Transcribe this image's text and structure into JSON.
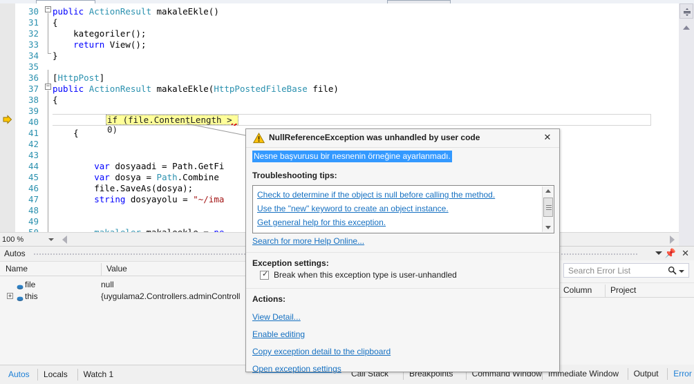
{
  "editor": {
    "zoom_level": "100 %",
    "lines": [
      {
        "num": "30",
        "indent": 0,
        "tokens": [
          {
            "t": "public ",
            "c": "kw"
          },
          {
            "t": "ActionResult ",
            "c": "typ"
          },
          {
            "t": "makaleEkle()",
            "c": "pln"
          }
        ]
      },
      {
        "num": "31",
        "indent": 0,
        "tokens": [
          {
            "t": "{",
            "c": "pln"
          }
        ]
      },
      {
        "num": "32",
        "indent": 0,
        "tokens": [
          {
            "t": "    kategoriler();",
            "c": "pln"
          }
        ]
      },
      {
        "num": "33",
        "indent": 0,
        "tokens": [
          {
            "t": "    ",
            "c": "pln"
          },
          {
            "t": "return ",
            "c": "kw"
          },
          {
            "t": "View();",
            "c": "pln"
          }
        ]
      },
      {
        "num": "34",
        "indent": 0,
        "tokens": [
          {
            "t": "}",
            "c": "pln"
          }
        ]
      },
      {
        "num": "35",
        "indent": 0,
        "tokens": []
      },
      {
        "num": "36",
        "indent": 0,
        "tokens": [
          {
            "t": "[",
            "c": "pln"
          },
          {
            "t": "HttpPost",
            "c": "typ"
          },
          {
            "t": "]",
            "c": "pln"
          }
        ]
      },
      {
        "num": "37",
        "indent": 0,
        "tokens": [
          {
            "t": "public ",
            "c": "kw"
          },
          {
            "t": "ActionResult ",
            "c": "typ"
          },
          {
            "t": "makaleEkle(",
            "c": "pln"
          },
          {
            "t": "HttpPostedFileBase ",
            "c": "typ"
          },
          {
            "t": "file)",
            "c": "pln"
          }
        ]
      },
      {
        "num": "38",
        "indent": 0,
        "tokens": [
          {
            "t": "{",
            "c": "pln"
          }
        ]
      },
      {
        "num": "39",
        "indent": 0,
        "tokens": []
      },
      {
        "num": "40",
        "indent": 0,
        "tokens": []
      },
      {
        "num": "41",
        "indent": 0,
        "tokens": [
          {
            "t": "    {",
            "c": "pln"
          }
        ]
      },
      {
        "num": "42",
        "indent": 0,
        "tokens": []
      },
      {
        "num": "43",
        "indent": 0,
        "tokens": []
      },
      {
        "num": "44",
        "indent": 0,
        "tokens": [
          {
            "t": "        ",
            "c": "pln"
          },
          {
            "t": "var ",
            "c": "kw"
          },
          {
            "t": "dosyaadi = Path.GetFi",
            "c": "pln"
          }
        ]
      },
      {
        "num": "45",
        "indent": 0,
        "tokens": [
          {
            "t": "        ",
            "c": "pln"
          },
          {
            "t": "var ",
            "c": "kw"
          },
          {
            "t": "dosya = ",
            "c": "pln"
          },
          {
            "t": "Path",
            "c": "typ"
          },
          {
            "t": ".Combine",
            "c": "pln"
          }
        ]
      },
      {
        "num": "46",
        "indent": 0,
        "tokens": [
          {
            "t": "        file.SaveAs(dosya);",
            "c": "pln"
          }
        ]
      },
      {
        "num": "47",
        "indent": 0,
        "tokens": [
          {
            "t": "        ",
            "c": "pln"
          },
          {
            "t": "string ",
            "c": "kw"
          },
          {
            "t": "dosyayolu = ",
            "c": "pln"
          },
          {
            "t": "\"~/ima",
            "c": "str"
          }
        ]
      },
      {
        "num": "48",
        "indent": 0,
        "tokens": []
      },
      {
        "num": "49",
        "indent": 0,
        "tokens": []
      },
      {
        "num": "50",
        "indent": 0,
        "tokens": [
          {
            "t": "        ",
            "c": "pln"
          },
          {
            "t": "makaleler",
            "c": "typ"
          },
          {
            "t": " makaleekle = ",
            "c": "pln"
          },
          {
            "t": "ne",
            "c": "kw"
          }
        ]
      }
    ],
    "highlighted_line": {
      "num": "40",
      "text": "if (file.ContentLength > 0)"
    }
  },
  "autos_panel": {
    "title": "Autos",
    "columns": [
      "Name",
      "Value"
    ],
    "rows": [
      {
        "name": "file",
        "value": "null",
        "expandable": false
      },
      {
        "name": "this",
        "value": "{uygulama2.Controllers.adminControll",
        "expandable": true,
        "expander": "+"
      }
    ]
  },
  "error_list_panel": {
    "search_placeholder": "Search Error List",
    "columns": [
      "Column",
      "Project"
    ],
    "icons": {
      "caret": "chevron-down-icon",
      "pin": "pin-icon",
      "close": "close-icon",
      "search": "search-icon"
    }
  },
  "bottom_tabs_left": [
    {
      "label": "Autos",
      "active": true
    },
    {
      "label": "Locals",
      "active": false
    },
    {
      "label": "Watch 1",
      "active": false
    }
  ],
  "bottom_tabs_right": [
    {
      "label": "Call Stack",
      "active": false
    },
    {
      "label": "Breakpoints",
      "active": false
    },
    {
      "label": "Command Window",
      "active": false
    },
    {
      "label": "Immediate Window",
      "active": false
    },
    {
      "label": "Output",
      "active": false
    },
    {
      "label": "Error List",
      "active": true
    }
  ],
  "exception_dialog": {
    "title": "NullReferenceException was unhandled by user code",
    "warning_icon": "warning-triangle-icon",
    "close_label": "✕",
    "message": "Nesne başvurusu bir nesnenin örneğine ayarlanmadı.",
    "tips_heading": "Troubleshooting tips:",
    "tips": [
      "Check to determine if the object is null before calling the method.",
      "Use the \"new\" keyword to create an object instance.",
      "Get general help for this exception."
    ],
    "search_help_link": "Search for more Help Online...",
    "settings_heading": "Exception settings:",
    "settings_checkbox": {
      "label": "Break when this exception type is user-unhandled",
      "checked": true,
      "mark": "✓"
    },
    "actions_heading": "Actions:",
    "actions": [
      "View Detail...",
      "Enable editing",
      "Copy exception detail to the clipboard",
      "Open exception settings"
    ]
  },
  "colors": {
    "link": "#1570c1",
    "selection": "#3399ff",
    "highlight": "#ffff99",
    "line_number": "#2b91af",
    "keyword": "#0000ff",
    "type": "#2b91af",
    "string": "#a31515"
  }
}
